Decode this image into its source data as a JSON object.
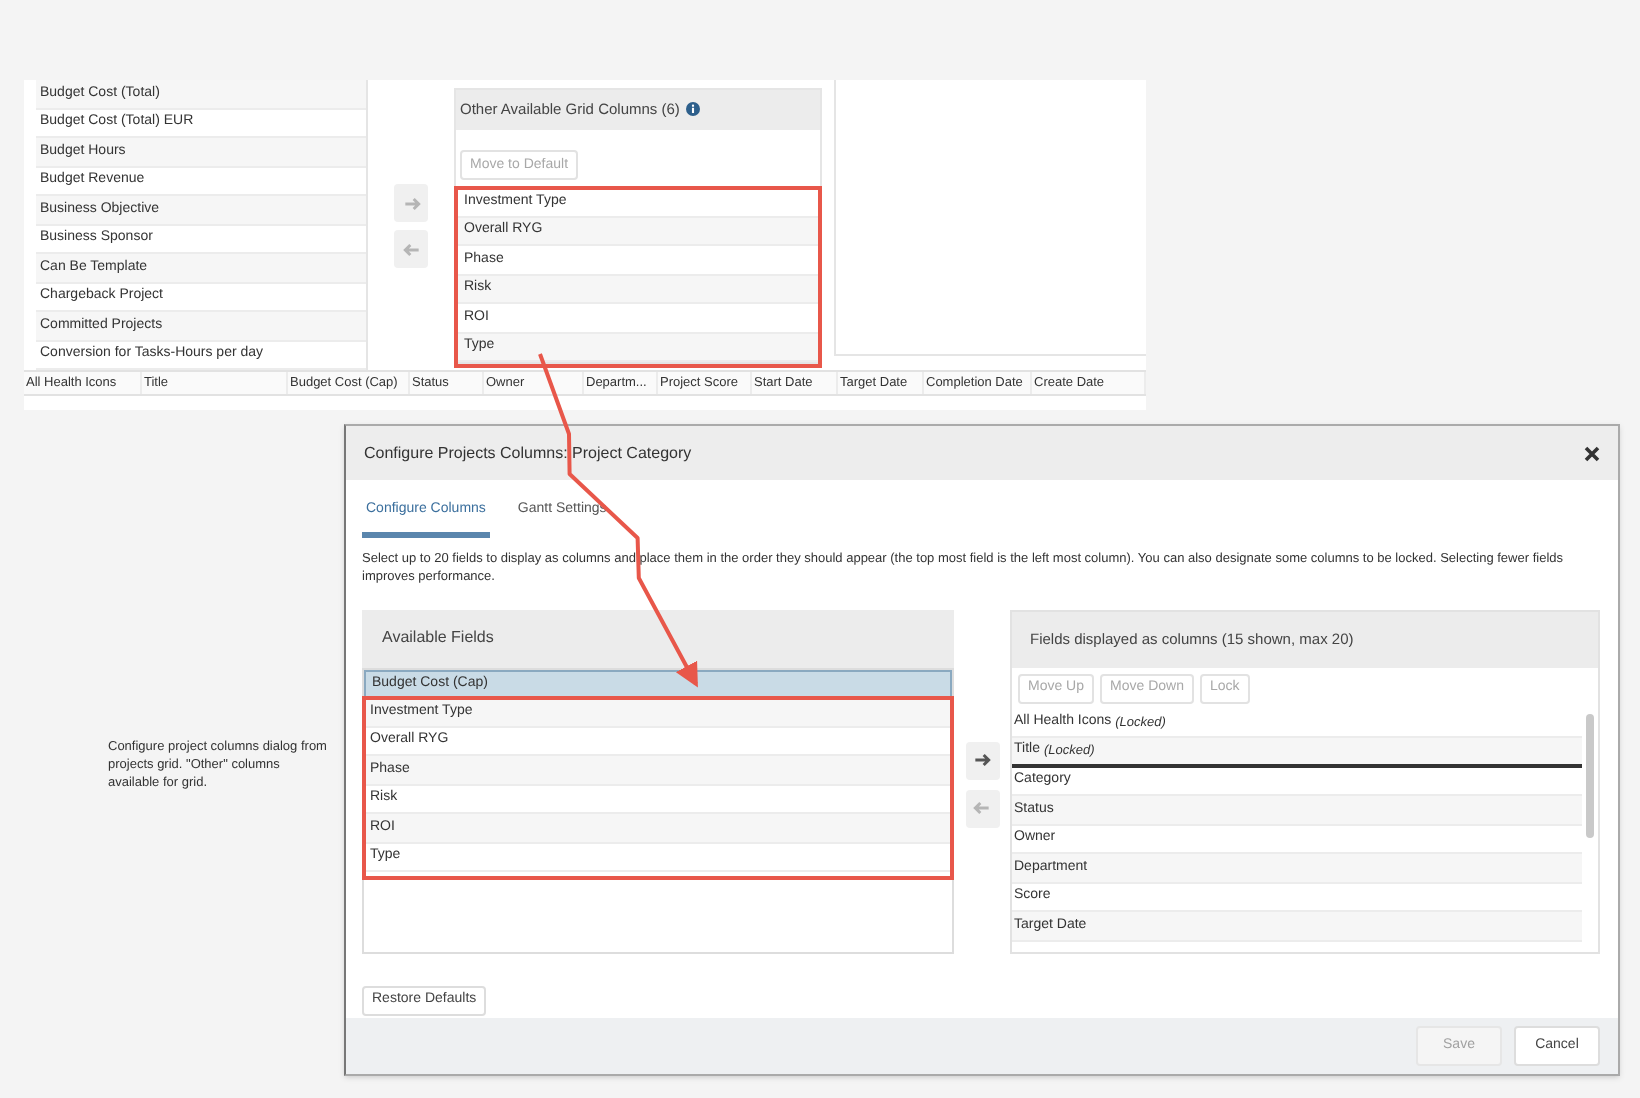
{
  "grid_screenshot": {
    "field_list": [
      {
        "label": "Budget Cost (Total)"
      },
      {
        "label": "Budget Cost (Total) EUR"
      },
      {
        "label": "Budget Hours"
      },
      {
        "label": "Budget Revenue"
      },
      {
        "label": "Business Objective"
      },
      {
        "label": "Business Sponsor"
      },
      {
        "label": "Can Be Template"
      },
      {
        "label": "Chargeback Project"
      },
      {
        "label": "Committed Projects"
      },
      {
        "label": "Conversion for Tasks-Hours per day"
      }
    ],
    "arrow_buttons": [
      {
        "kind": "right",
        "disabled": true
      },
      {
        "kind": "left",
        "disabled": true
      }
    ],
    "other_columns": {
      "title": "Other Available Grid Columns (6)",
      "move_button": {
        "label": "Move to Default",
        "disabled": true
      },
      "items": [
        {
          "label": "Investment Type"
        },
        {
          "label": "Overall RYG"
        },
        {
          "label": "Phase"
        },
        {
          "label": "Risk"
        },
        {
          "label": "ROI"
        },
        {
          "label": "Type"
        }
      ]
    },
    "table_columns": [
      "All Health Icons",
      "Title",
      "Budget Cost (Cap)",
      "Status",
      "Owner",
      "Departm...",
      "Project Score",
      "Start Date",
      "Target Date",
      "Completion Date",
      "Create Date"
    ]
  },
  "caption": "Configure project columns dialog from projects grid. \"Other\" columns available for grid.",
  "dialog": {
    "title": "Configure Projects Columns: Project Category",
    "tabs": [
      {
        "label": "Configure Columns",
        "selected": true
      },
      {
        "label": "Gantt Settings",
        "selected": false
      }
    ],
    "description": "Select up to 20 fields to display as columns and place them in the order they should appear (the top most field is the left most column). You can also designate some columns to be locked. Selecting fewer fields improves performance.",
    "available_fields": {
      "title": "Available Fields",
      "items": [
        {
          "label": "Budget Cost (Cap)",
          "selected": true
        },
        {
          "label": "Investment Type",
          "selected": false
        },
        {
          "label": "Overall RYG",
          "selected": false
        },
        {
          "label": "Phase",
          "selected": false
        },
        {
          "label": "Risk",
          "selected": false
        },
        {
          "label": "ROI",
          "selected": false
        },
        {
          "label": "Type",
          "selected": false
        }
      ]
    },
    "arrow_buttons": [
      {
        "kind": "right",
        "disabled": false
      },
      {
        "kind": "left",
        "disabled": true
      }
    ],
    "displayed_fields": {
      "title": "Fields displayed as columns (15 shown, max 20)",
      "buttons": [
        {
          "label": "Move Up",
          "disabled": true
        },
        {
          "label": "Move Down",
          "disabled": true
        },
        {
          "label": "Lock",
          "disabled": true
        }
      ],
      "items": [
        {
          "label": "All Health Icons",
          "note": "(Locked)"
        },
        {
          "label": "Title",
          "note": "(Locked)"
        },
        {
          "label": "Category"
        },
        {
          "label": "Status"
        },
        {
          "label": "Owner"
        },
        {
          "label": "Department"
        },
        {
          "label": "Score"
        },
        {
          "label": "Target Date"
        }
      ]
    },
    "restore_button": {
      "label": "Restore Defaults",
      "disabled": false
    },
    "footer_buttons": [
      {
        "label": "Save",
        "disabled": true
      },
      {
        "label": "Cancel",
        "disabled": false
      }
    ]
  }
}
